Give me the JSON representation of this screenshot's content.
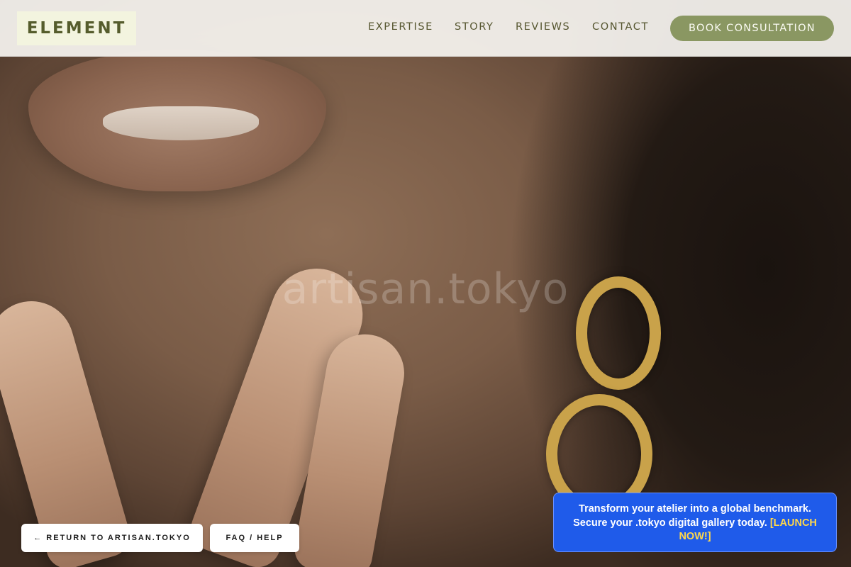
{
  "brand": {
    "logo_text": "ELEMENT"
  },
  "nav": {
    "items": [
      {
        "label": "EXPERTISE"
      },
      {
        "label": "STORY"
      },
      {
        "label": "REVIEWS"
      },
      {
        "label": "CONTACT"
      }
    ],
    "cta_label": "BOOK CONSULTATION"
  },
  "hero": {
    "watermark": "artisan.tokyo"
  },
  "footer_buttons": {
    "return_label": "← RETURN TO ARTISAN.TOKYO",
    "faq_label": "FAQ / HELP"
  },
  "promo": {
    "line1": "Transform your atelier into a global benchmark.",
    "line2": "Secure your .tokyo digital gallery today.",
    "link": "[LAUNCH NOW!]"
  },
  "colors": {
    "accent_olive": "#8a9762",
    "logo_text": "#555c2c",
    "promo_blue": "#1f5bea",
    "promo_link": "#ffd84a"
  }
}
